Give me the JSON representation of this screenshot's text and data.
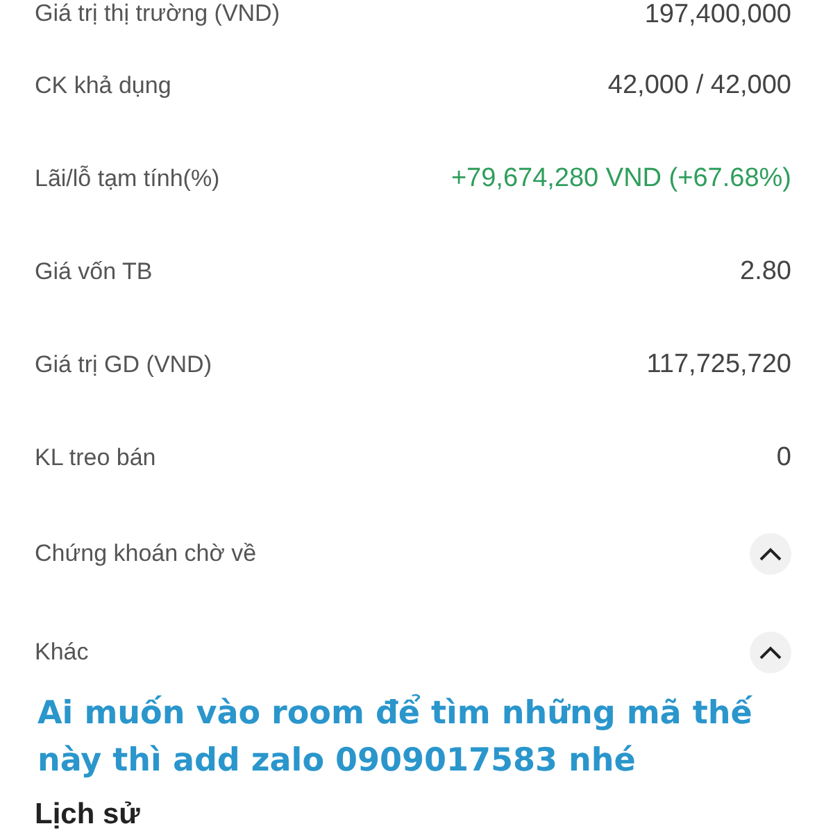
{
  "details": [
    {
      "label": "Giá trị thị trường (VND)",
      "value": "197,400,000",
      "kind": "text"
    },
    {
      "label": "CK khả dụng",
      "value": "42,000 / 42,000",
      "kind": "text"
    },
    {
      "label": "Lãi/lỗ tạm tính(%)",
      "value": "+79,674,280 VND (+67.68%)",
      "kind": "gain"
    },
    {
      "label": "Giá vốn TB",
      "value": "2.80",
      "kind": "text"
    },
    {
      "label": "Giá trị GD (VND)",
      "value": "117,725,720",
      "kind": "text"
    },
    {
      "label": "KL treo bán",
      "value": "0",
      "kind": "text"
    },
    {
      "label": "Chứng khoán chờ về",
      "kind": "section",
      "expanded": true
    },
    {
      "label": "Khác",
      "kind": "section",
      "expanded": true
    }
  ],
  "caption": "Ai muốn vào room để tìm những mã thế này thì add zalo 0909017583 nhé",
  "history": {
    "title": "Lịch sử"
  }
}
